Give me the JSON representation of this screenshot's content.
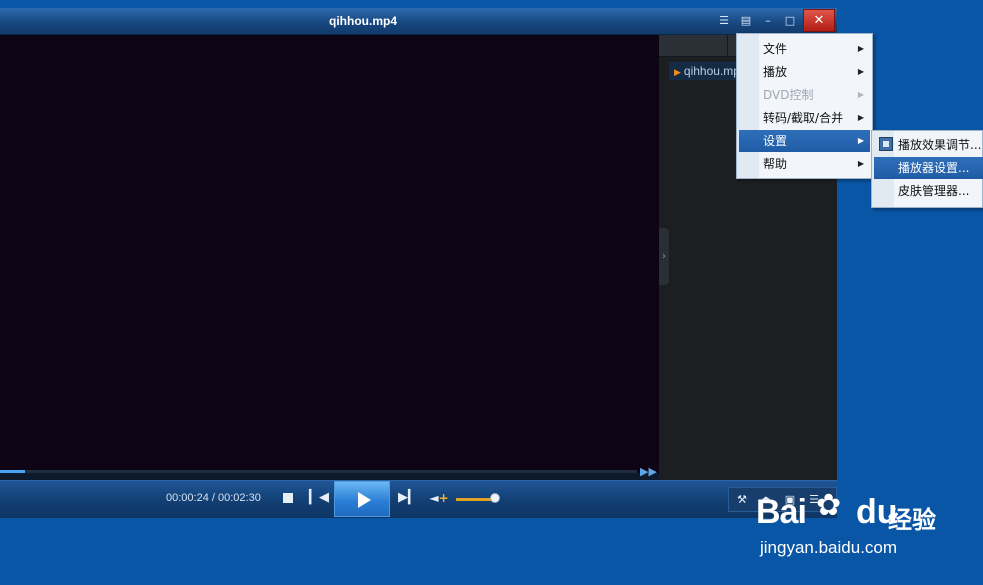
{
  "window": {
    "title": "qihhou.mp4",
    "controls": {
      "feedback": "☰",
      "mini": "▤",
      "minimize": "–",
      "maximize": "□",
      "close": "✕"
    }
  },
  "playlist": {
    "items": [
      {
        "label": "qihhou.mp4",
        "playing": true
      }
    ]
  },
  "playback": {
    "progress_fraction": 0.04,
    "time_current": "00:00:24",
    "time_total": "00:02:30",
    "time_display": "00:00:24 / 00:02:30",
    "volume_fraction": 0.92
  },
  "main_menu": {
    "items": [
      {
        "label": "文件",
        "state": "normal"
      },
      {
        "label": "播放",
        "state": "normal"
      },
      {
        "label": "DVD控制",
        "state": "disabled"
      },
      {
        "label": "转码/截取/合并",
        "state": "normal"
      },
      {
        "label": "设置",
        "state": "highlighted"
      },
      {
        "label": "帮助",
        "state": "normal"
      }
    ]
  },
  "settings_submenu": {
    "items": [
      {
        "label": "播放效果调节...",
        "state": "normal",
        "icon": "settings-panel-icon"
      },
      {
        "label": "播放器设置...",
        "state": "highlighted"
      },
      {
        "label": "皮肤管理器...",
        "state": "normal"
      }
    ]
  },
  "watermark": {
    "brand": "Baidu",
    "bai": "Bai",
    "du": "du",
    "jingyan": "经验",
    "url": "jingyan.baidu.com"
  },
  "colors": {
    "desktop": "#0a56a6",
    "video": "#0f0413",
    "accent": "#2f6fba",
    "close": "#c9302c"
  }
}
